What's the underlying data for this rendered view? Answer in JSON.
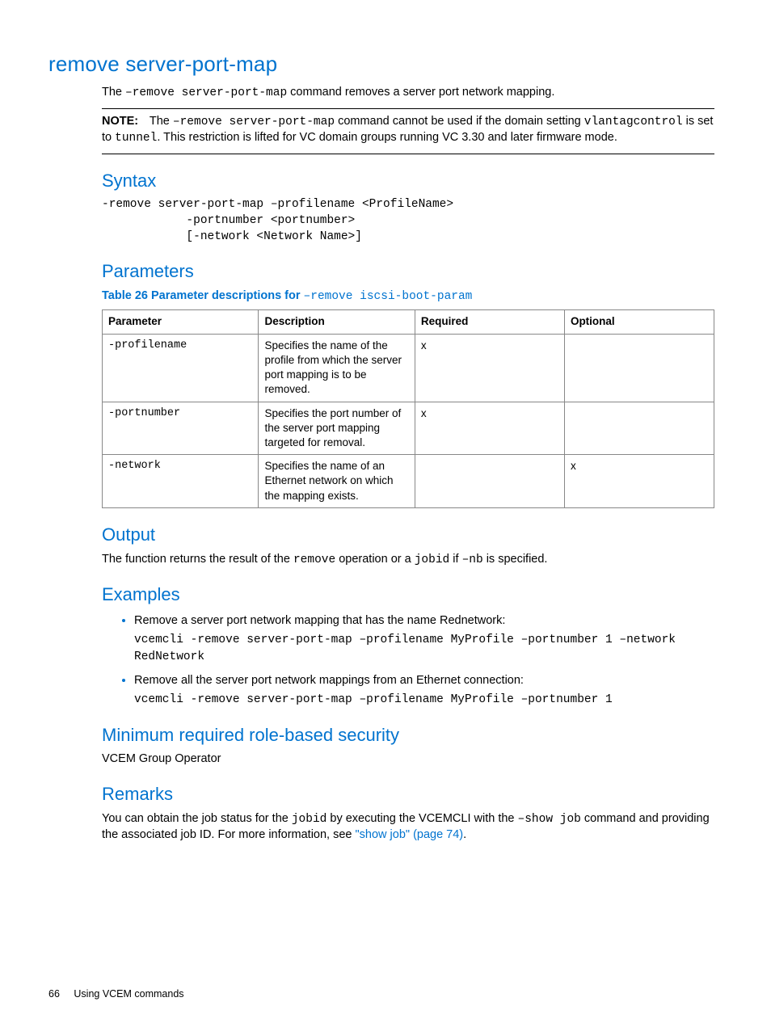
{
  "title": "remove server-port-map",
  "intro": {
    "pre": "The ",
    "cmd": "–remove server-port-map",
    "post": " command removes a server port network mapping."
  },
  "note": {
    "label": "NOTE:",
    "p1a": "The ",
    "p1cmd": "–remove server-port-map",
    "p1b": " command cannot be used if the domain setting ",
    "p2a": "vlantagcontrol",
    "p2b": " is set to ",
    "p2c": "tunnel",
    "p2d": ". This restriction is lifted for VC domain groups running VC 3.30 and later firmware mode."
  },
  "syntax": {
    "heading": "Syntax",
    "code": "-remove server-port-map –profilename <ProfileName>\n            -portnumber <portnumber>\n            [-network <Network Name>]"
  },
  "parameters": {
    "heading": "Parameters",
    "caption_pre": "Table 26 Parameter descriptions for ",
    "caption_code": "–remove iscsi-boot-param",
    "headers": {
      "c1": "Parameter",
      "c2": "Description",
      "c3": "Required",
      "c4": "Optional"
    },
    "rows": [
      {
        "param": "-profilename",
        "desc": "Specifies the name of the profile from which the server port mapping is to be removed.",
        "req": "x",
        "opt": ""
      },
      {
        "param": "-portnumber",
        "desc": "Specifies the port number of the server port mapping targeted for removal.",
        "req": "x",
        "opt": ""
      },
      {
        "param": "-network",
        "desc": "Specifies the name of an Ethernet network on which the mapping exists.",
        "req": "",
        "opt": "x"
      }
    ]
  },
  "output": {
    "heading": "Output",
    "pre": "The function returns the result of the ",
    "c1": "remove",
    "mid": " operation or a ",
    "c2": "jobid",
    "mid2": " if ",
    "c3": "–nb",
    "post": " is specified."
  },
  "examples": {
    "heading": "Examples",
    "items": [
      {
        "text": "Remove a server port network mapping that has the name Rednetwork:",
        "code": "vcemcli -remove server-port-map –profilename MyProfile –portnumber 1 –network RedNetwork"
      },
      {
        "text": "Remove all the server port network mappings from an Ethernet connection:",
        "code": "vcemcli -remove server-port-map –profilename MyProfile –portnumber 1"
      }
    ]
  },
  "minrole": {
    "heading": "Minimum required role-based security",
    "text": "VCEM Group Operator"
  },
  "remarks": {
    "heading": "Remarks",
    "p1": "You can obtain the job status for the ",
    "c1": "jobid",
    "p2": " by executing the VCEMCLI with the ",
    "c2": "–show job",
    "p3": " command and providing the associated job ID. For more information, see ",
    "link": "\"show job\" (page 74)",
    "p4": "."
  },
  "footer": {
    "page": "66",
    "section": "Using VCEM commands"
  }
}
